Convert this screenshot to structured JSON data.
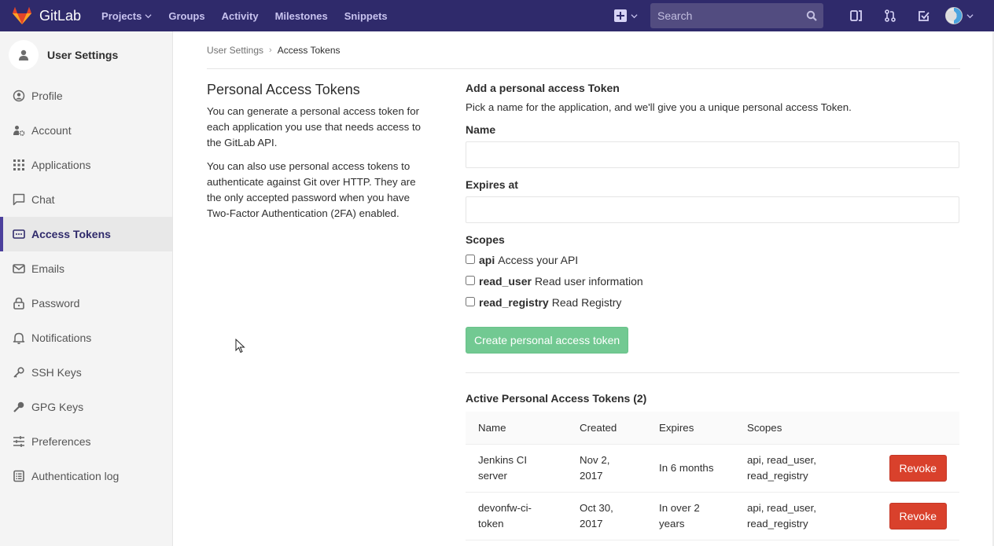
{
  "navbar": {
    "brand": "GitLab",
    "links": [
      {
        "label": "Projects",
        "has_dropdown": true
      },
      {
        "label": "Groups"
      },
      {
        "label": "Activity"
      },
      {
        "label": "Milestones"
      },
      {
        "label": "Snippets"
      }
    ],
    "search_placeholder": "Search",
    "icons": [
      "plus-square-icon",
      "sidebar-toggle-icon",
      "merge-request-icon",
      "todo-check-icon",
      "user-avatar"
    ],
    "colors": {
      "bg": "#2f2a6b",
      "link": "#c8c3ef",
      "search_bg": "#524c80"
    }
  },
  "sidebar": {
    "context_title": "User Settings",
    "items": [
      {
        "label": "Profile",
        "icon": "profile-icon"
      },
      {
        "label": "Account",
        "icon": "account-icon"
      },
      {
        "label": "Applications",
        "icon": "applications-icon"
      },
      {
        "label": "Chat",
        "icon": "chat-icon"
      },
      {
        "label": "Access Tokens",
        "icon": "access-tokens-icon",
        "active": true
      },
      {
        "label": "Emails",
        "icon": "email-icon"
      },
      {
        "label": "Password",
        "icon": "lock-icon"
      },
      {
        "label": "Notifications",
        "icon": "bell-icon"
      },
      {
        "label": "SSH Keys",
        "icon": "key-icon"
      },
      {
        "label": "GPG Keys",
        "icon": "key-icon"
      },
      {
        "label": "Preferences",
        "icon": "sliders-icon"
      },
      {
        "label": "Authentication log",
        "icon": "log-icon"
      }
    ]
  },
  "breadcrumb": {
    "parent": "User Settings",
    "current": "Access Tokens"
  },
  "intro": {
    "title": "Personal Access Tokens",
    "paragraph1": "You can generate a personal access token for each application you use that needs access to the GitLab API.",
    "paragraph2": "You can also use personal access tokens to authenticate against Git over HTTP. They are the only accepted password when you have Two-Factor Authentication (2FA) enabled."
  },
  "form": {
    "title": "Add a personal access Token",
    "subtitle": "Pick a name for the application, and we'll give you a unique personal access Token.",
    "name_label": "Name",
    "name_value": "",
    "expires_label": "Expires at",
    "expires_value": "",
    "scopes_label": "Scopes",
    "scopes": [
      {
        "name": "api",
        "description": "Access your API",
        "checked": false
      },
      {
        "name": "read_user",
        "description": "Read user information",
        "checked": false
      },
      {
        "name": "read_registry",
        "description": "Read Registry",
        "checked": false
      }
    ],
    "submit_label": "Create personal access token",
    "submit_color": "#72c992"
  },
  "active_tokens": {
    "title": "Active Personal Access Tokens (2)",
    "columns": [
      "Name",
      "Created",
      "Expires",
      "Scopes",
      ""
    ],
    "rows": [
      {
        "name": "Jenkins CI server",
        "created": "Nov 2, 2017",
        "expires": "In 6 months",
        "scopes": "api, read_user, read_registry",
        "action": "Revoke"
      },
      {
        "name": "devonfw-ci-token",
        "created": "Oct 30, 2017",
        "expires": "In over 2 years",
        "scopes": "api, read_user, read_registry",
        "action": "Revoke"
      }
    ],
    "revoke_color": "#d9412c"
  }
}
